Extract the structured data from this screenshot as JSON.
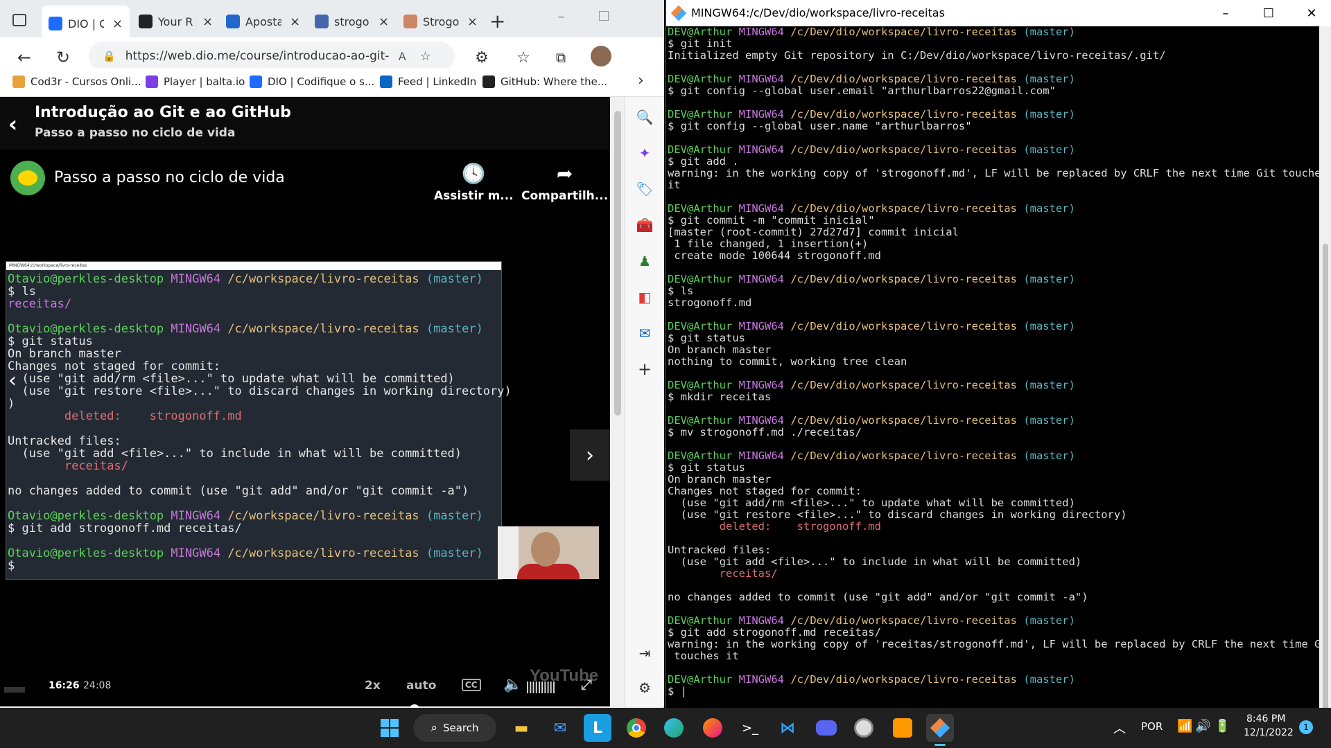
{
  "browser": {
    "tabs": [
      {
        "label": "DIO | C",
        "icon": "dio-icon",
        "color": "#1e6bff",
        "active": true
      },
      {
        "label": "Your R",
        "icon": "github-icon",
        "color": "#222222",
        "active": false
      },
      {
        "label": "Aposta",
        "icon": "sb-icon",
        "color": "#2266cc",
        "active": false
      },
      {
        "label": "strogo",
        "icon": "search-icon",
        "color": "#4466aa",
        "active": false
      },
      {
        "label": "Strogo",
        "icon": "food-icon",
        "color": "#cc8866",
        "active": false
      }
    ],
    "url": "https://web.dio.me/course/introducao-ao-git-...",
    "bookmarks": [
      {
        "label": "Cod3r - Cursos Onli...",
        "icon": "cod3r-icon",
        "color": "#e9a23b"
      },
      {
        "label": "Player | balta.io",
        "icon": "balta-icon",
        "color": "#7b3fe4"
      },
      {
        "label": "DIO | Codifique o s...",
        "icon": "dio-icon",
        "color": "#1e6bff"
      },
      {
        "label": "Feed | LinkedIn",
        "icon": "linkedin-icon",
        "color": "#0a66c2"
      },
      {
        "label": "GitHub: Where the...",
        "icon": "github-icon",
        "color": "#222222"
      }
    ],
    "page": {
      "course_title": "Introdução ao Git e ao GitHub",
      "course_subtitle": "Passo a passo no ciclo de vida",
      "video_title": "Passo a passo no ciclo de vida",
      "watch_later": "Assistir m...",
      "share": "Compartilh...",
      "current_time": "16:26",
      "duration": "24:08",
      "speed": "2x",
      "quality": "auto",
      "cc": "CC",
      "yt_watermark": "YouTube",
      "progress": 0.68,
      "buffered": 0.77,
      "inner_terminal_title": "MINGW64:/c/workspace/livro-receitas"
    }
  },
  "inner_terminal": {
    "prompt_user": "Otavio@perkles-desktop",
    "prompt_env": "MINGW64",
    "prompt_path": "/c/workspace/livro-receitas",
    "prompt_branch": "(master)",
    "lines": [
      {
        "type": "prompt"
      },
      {
        "type": "out",
        "text": "$ ls"
      },
      {
        "type": "out",
        "text": "receitas/",
        "cls": "c-purple"
      },
      {
        "type": "blank"
      },
      {
        "type": "prompt"
      },
      {
        "type": "out",
        "text": "$ git status"
      },
      {
        "type": "out",
        "text": "On branch master"
      },
      {
        "type": "out",
        "text": "Changes not staged for commit:"
      },
      {
        "type": "out",
        "text": "  (use \"git add/rm <file>...\" to update what will be committed)"
      },
      {
        "type": "out",
        "text": "  (use \"git restore <file>...\" to discard changes in working directory)"
      },
      {
        "type": "out",
        "text": ")"
      },
      {
        "type": "out",
        "text": "        deleted:    strogonoff.md",
        "cls": "c-red"
      },
      {
        "type": "blank"
      },
      {
        "type": "out",
        "text": "Untracked files:"
      },
      {
        "type": "out",
        "text": "  (use \"git add <file>...\" to include in what will be committed)"
      },
      {
        "type": "out",
        "text": "        receitas/",
        "cls": "c-red"
      },
      {
        "type": "blank"
      },
      {
        "type": "out",
        "text": "no changes added to commit (use \"git add\" and/or \"git commit -a\")"
      },
      {
        "type": "blank"
      },
      {
        "type": "prompt"
      },
      {
        "type": "out",
        "text": "$ git add strogonoff.md receitas/"
      },
      {
        "type": "blank"
      },
      {
        "type": "prompt"
      },
      {
        "type": "out",
        "text": "$"
      }
    ]
  },
  "terminal": {
    "title": "MINGW64:/c/Dev/dio/workspace/livro-receitas",
    "prompt_user": "DEV@Arthur",
    "prompt_env": "MINGW64",
    "prompt_path": "/c/Dev/dio/workspace/livro-receitas",
    "prompt_branch": "(master)",
    "lines": [
      {
        "type": "prompt"
      },
      {
        "type": "out",
        "text": "$ git init"
      },
      {
        "type": "out",
        "text": "Initialized empty Git repository in C:/Dev/dio/workspace/livro-receitas/.git/"
      },
      {
        "type": "blank"
      },
      {
        "type": "prompt"
      },
      {
        "type": "out",
        "text": "$ git config --global user.email \"arthurlbarros22@gmail.com\""
      },
      {
        "type": "blank"
      },
      {
        "type": "prompt"
      },
      {
        "type": "out",
        "text": "$ git config --global user.name \"arthurlbarros\""
      },
      {
        "type": "blank"
      },
      {
        "type": "prompt"
      },
      {
        "type": "out",
        "text": "$ git add ."
      },
      {
        "type": "out",
        "text": "warning: in the working copy of 'strogonoff.md', LF will be replaced by CRLF the next time Git touches"
      },
      {
        "type": "out",
        "text": "it"
      },
      {
        "type": "blank"
      },
      {
        "type": "prompt"
      },
      {
        "type": "out",
        "text": "$ git commit -m \"commit inicial\""
      },
      {
        "type": "out",
        "text": "[master (root-commit) 27d27d7] commit inicial"
      },
      {
        "type": "out",
        "text": " 1 file changed, 1 insertion(+)"
      },
      {
        "type": "out",
        "text": " create mode 100644 strogonoff.md"
      },
      {
        "type": "blank"
      },
      {
        "type": "prompt"
      },
      {
        "type": "out",
        "text": "$ ls"
      },
      {
        "type": "out",
        "text": "strogonoff.md"
      },
      {
        "type": "blank"
      },
      {
        "type": "prompt"
      },
      {
        "type": "out",
        "text": "$ git status"
      },
      {
        "type": "out",
        "text": "On branch master"
      },
      {
        "type": "out",
        "text": "nothing to commit, working tree clean"
      },
      {
        "type": "blank"
      },
      {
        "type": "prompt"
      },
      {
        "type": "out",
        "text": "$ mkdir receitas"
      },
      {
        "type": "blank"
      },
      {
        "type": "prompt"
      },
      {
        "type": "out",
        "text": "$ mv strogonoff.md ./receitas/"
      },
      {
        "type": "blank"
      },
      {
        "type": "prompt"
      },
      {
        "type": "out",
        "text": "$ git status"
      },
      {
        "type": "out",
        "text": "On branch master"
      },
      {
        "type": "out",
        "text": "Changes not staged for commit:"
      },
      {
        "type": "out",
        "text": "  (use \"git add/rm <file>...\" to update what will be committed)"
      },
      {
        "type": "out",
        "text": "  (use \"git restore <file>...\" to discard changes in working directory)"
      },
      {
        "type": "out",
        "text": "        deleted:    strogonoff.md",
        "cls": "c-red"
      },
      {
        "type": "blank"
      },
      {
        "type": "out",
        "text": "Untracked files:"
      },
      {
        "type": "out",
        "text": "  (use \"git add <file>...\" to include in what will be committed)"
      },
      {
        "type": "out",
        "text": "        receitas/",
        "cls": "c-red"
      },
      {
        "type": "blank"
      },
      {
        "type": "out",
        "text": "no changes added to commit (use \"git add\" and/or \"git commit -a\")"
      },
      {
        "type": "blank"
      },
      {
        "type": "prompt"
      },
      {
        "type": "out",
        "text": "$ git add strogonoff.md receitas/"
      },
      {
        "type": "out",
        "text": "warning: in the working copy of 'receitas/strogonoff.md', LF will be replaced by CRLF the next time Git"
      },
      {
        "type": "out",
        "text": " touches it"
      },
      {
        "type": "blank"
      },
      {
        "type": "prompt"
      },
      {
        "type": "out",
        "text": "$ |"
      }
    ]
  },
  "taskbar": {
    "search_label": "Search",
    "apps": [
      {
        "icon": "windows-start-icon"
      },
      {
        "icon": "file-explorer-icon"
      },
      {
        "icon": "mail-icon"
      },
      {
        "icon": "libreoffice-icon"
      },
      {
        "icon": "chrome-icon"
      },
      {
        "icon": "edge-icon"
      },
      {
        "icon": "firefox-icon"
      },
      {
        "icon": "terminal-icon"
      },
      {
        "icon": "vscode-icon"
      },
      {
        "icon": "discord-icon"
      },
      {
        "icon": "clock-app-icon"
      },
      {
        "icon": "sublime-icon"
      },
      {
        "icon": "git-bash-icon"
      }
    ],
    "language": "POR",
    "time": "8:46 PM",
    "date": "12/1/2022",
    "notification_count": "1"
  }
}
